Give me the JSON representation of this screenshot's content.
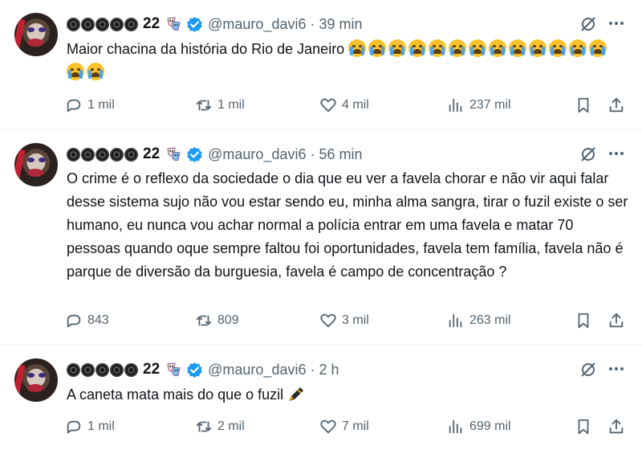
{
  "colors": {
    "verified": "#1d9bf0",
    "muted": "#536471",
    "text": "#0f1419",
    "divider": "#eff3f4"
  },
  "icons": {
    "name_circles": "black-circle-icon",
    "mask": "performing-arts-mask-icon",
    "verified": "verified-badge-icon",
    "grok": "grok-icon",
    "more": "more-icon",
    "reply": "reply-icon",
    "retweet": "retweet-icon",
    "like": "heart-icon",
    "views": "views-bar-chart-icon",
    "bookmark": "bookmark-icon",
    "share": "share-icon"
  },
  "tweets": [
    {
      "display_name": "22",
      "handle": "@mauro_davi6",
      "separator": "·",
      "time": "39 min",
      "text": "Maior chacina da história do Rio de Janeiro",
      "emoji_count": 15,
      "emoji": "loudly-crying-face-emoji",
      "replies": "1 mil",
      "retweets": "1 mil",
      "likes": "4 mil",
      "views": "237 mil"
    },
    {
      "display_name": "22",
      "handle": "@mauro_davi6",
      "separator": "·",
      "time": "56 min",
      "text": "O crime é o reflexo da sociedade o dia que eu ver a favela chorar e não vir aqui falar desse sistema sujo não vou estar sendo eu, minha alma sangra, tirar o fuzil existe o ser humano, eu nunca vou achar normal a polícia entrar em uma favela e matar 70 pessoas quando oque sempre faltou foi oportunidades, favela tem família, favela não é parque de diversão da burguesia, favela é campo de concentração ?",
      "replies": "843",
      "retweets": "809",
      "likes": "3 mil",
      "views": "263 mil"
    },
    {
      "display_name": "22",
      "handle": "@mauro_davi6",
      "separator": "·",
      "time": "2 h",
      "text": "A caneta mata mais do que o fuzil",
      "emoji": "fountain-pen-emoji",
      "replies": "1 mil",
      "retweets": "2 mil",
      "likes": "7 mil",
      "views": "699 mil"
    }
  ]
}
